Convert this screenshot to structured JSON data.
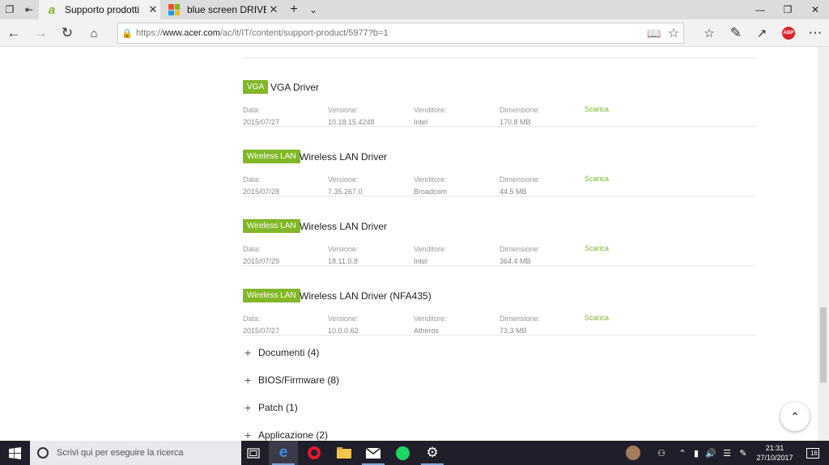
{
  "browser": {
    "tabs": [
      {
        "title": "Supporto prodotti",
        "favicon": "acer-logo-icon"
      },
      {
        "title": "blue screen DRIVER IRQL N",
        "favicon": "microsoft-logo-icon"
      }
    ],
    "url_prefix": "https://",
    "url_host": "www.acer.com",
    "url_path": "/ac/it/IT/content/support-product/5977?b=1",
    "abp_label": "ABP"
  },
  "drivers": [
    {
      "badge": "VGA",
      "name": "VGA Driver",
      "date": "2015/07/27",
      "version": "10.18.15.4248",
      "vendor": "Intel",
      "size": "170.8 MB",
      "download": "Scarica"
    },
    {
      "badge": "Wireless LAN",
      "name": "Wireless LAN Driver",
      "date": "2015/07/28",
      "version": "7.35.267.0",
      "vendor": "Broadcom",
      "size": "44.5 MB",
      "download": "Scarica"
    },
    {
      "badge": "Wireless LAN",
      "name": "Wireless LAN Driver",
      "date": "2015/07/29",
      "version": "18.11.0.8",
      "vendor": "Intel",
      "size": "364.4 MB",
      "download": "Scarica"
    },
    {
      "badge": "Wireless LAN",
      "name": "Wireless LAN Driver (NFA435)",
      "date": "2015/07/27",
      "version": "10.0.0.62",
      "vendor": "Atheros",
      "size": "73.3 MB",
      "download": "Scarica"
    }
  ],
  "labels": {
    "date": "Data:",
    "version": "Versione:",
    "vendor": "Venditore:",
    "size": "Dimensione:"
  },
  "sections": [
    {
      "label": "Documenti (4)"
    },
    {
      "label": "BIOS/Firmware (8)"
    },
    {
      "label": "Patch (1)"
    },
    {
      "label": "Applicazione (2)"
    }
  ],
  "taskbar": {
    "search_placeholder": "Scrivi qui per eseguire la ricerca",
    "time": "21:31",
    "date": "27/10/2017",
    "notifications": "16"
  },
  "colors": {
    "accent_green": "#82b729",
    "link_green": "#7cb531",
    "taskbar_bg": "#1f1f2b"
  }
}
